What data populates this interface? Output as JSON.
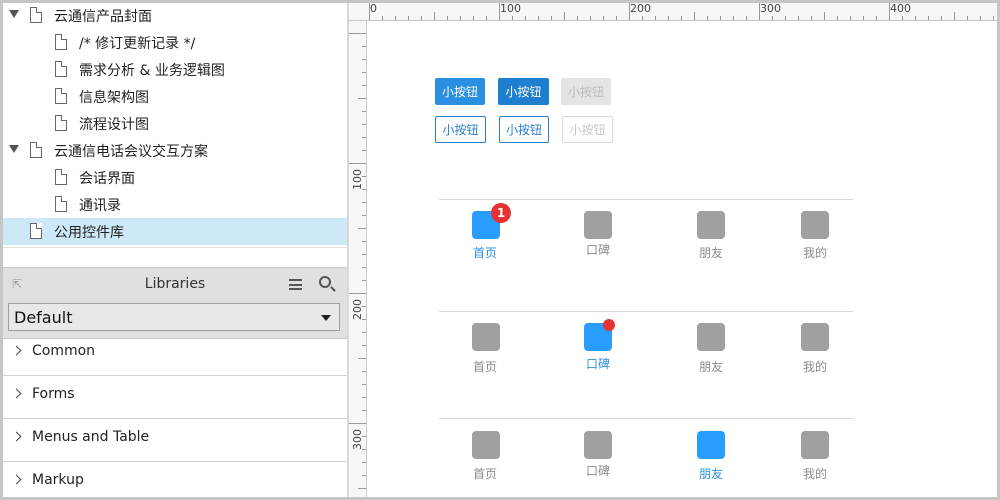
{
  "pages": [
    {
      "label": "云通信产品封面",
      "level": 0,
      "expanded": true
    },
    {
      "label": "/* 修订更新记录 */",
      "level": 1
    },
    {
      "label": "需求分析 & 业务逻辑图",
      "level": 1
    },
    {
      "label": "信息架构图",
      "level": 1
    },
    {
      "label": "流程设计图",
      "level": 1
    },
    {
      "label": "云通信电话会议交互方案",
      "level": 0,
      "expanded": true
    },
    {
      "label": "会话界面",
      "level": 1
    },
    {
      "label": "通讯录",
      "level": 1
    },
    {
      "label": "公用控件库",
      "level": 0,
      "selected": true
    }
  ],
  "libraries": {
    "title": "Libraries",
    "pin_icon": "⇱",
    "selected": "Default",
    "categories": [
      "Common",
      "Forms",
      "Menus and Table",
      "Markup"
    ]
  },
  "ruler": {
    "top": [
      "0",
      "100",
      "200",
      "300",
      "400"
    ],
    "left": [
      "100",
      "200",
      "300"
    ]
  },
  "canvas": {
    "buttons_row1": [
      "小按钮",
      "小按钮",
      "小按钮"
    ],
    "buttons_row2": [
      "小按钮",
      "小按钮",
      "小按钮"
    ],
    "tabbars": [
      {
        "labels": [
          "首页",
          "口碑",
          "朋友",
          "我的"
        ],
        "active": 0,
        "badge": "1"
      },
      {
        "labels": [
          "首页",
          "口碑",
          "朋友",
          "我的"
        ],
        "active": 1,
        "dot": true
      },
      {
        "labels": [
          "首页",
          "口碑",
          "朋友",
          "我的"
        ],
        "active": 2
      }
    ]
  },
  "colors": {
    "accent": "#2b8fe1",
    "badge": "#e53333",
    "selection": "#cde8f7"
  }
}
